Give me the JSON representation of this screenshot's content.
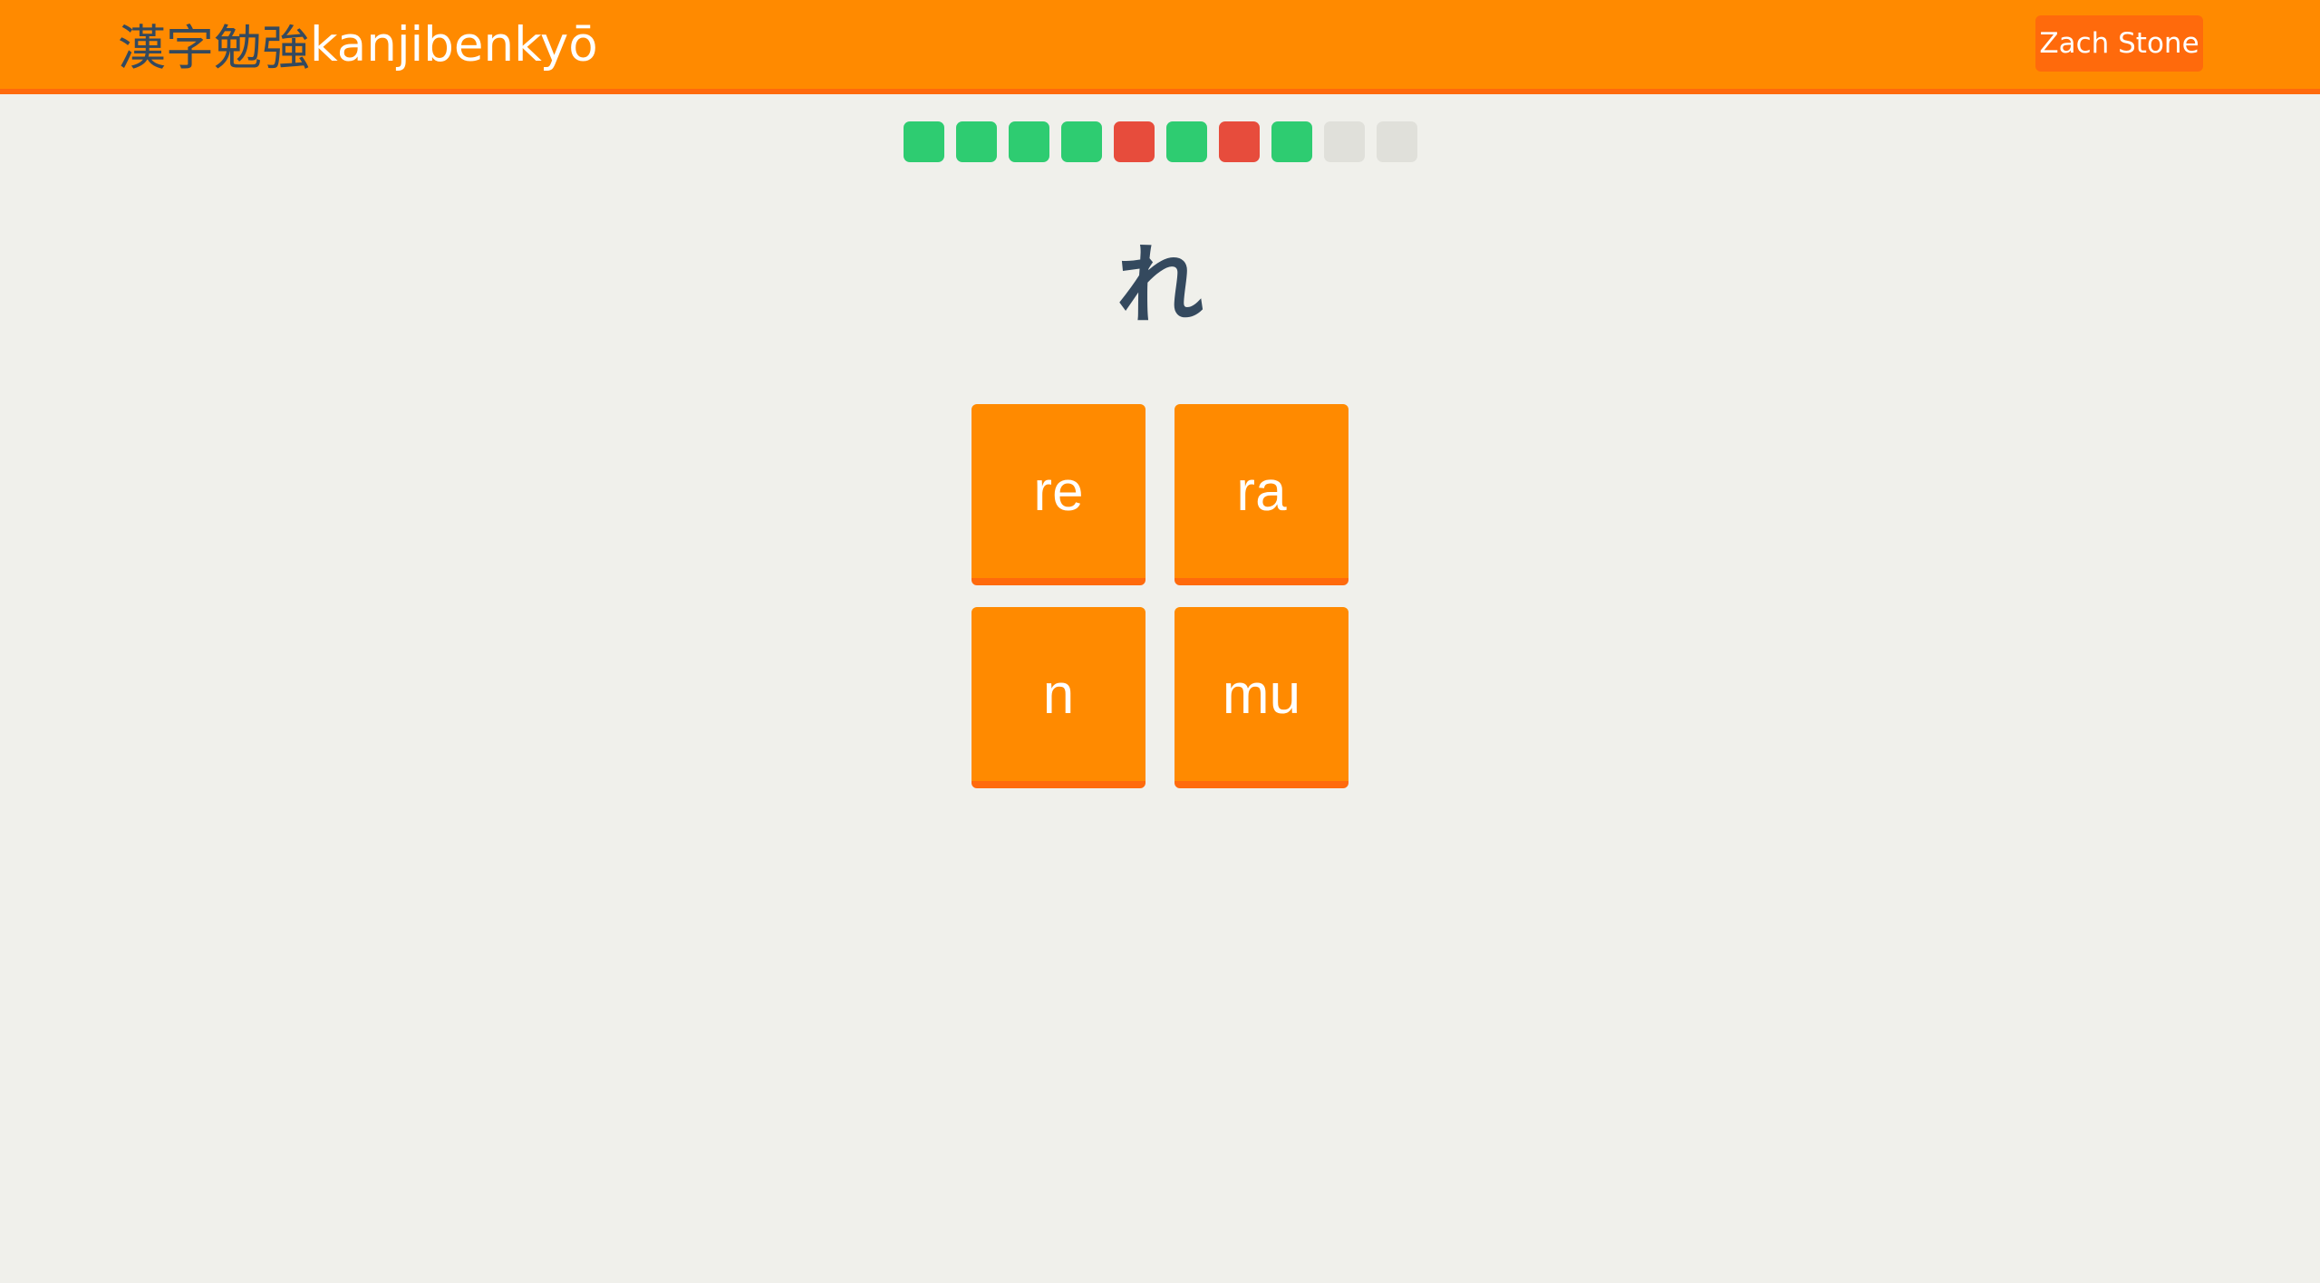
{
  "header": {
    "brand_kanji": "漢字勉強",
    "brand_romaji": "kanjibenkyō",
    "user_name": "Zach Stone"
  },
  "progress": [
    "correct",
    "correct",
    "correct",
    "correct",
    "wrong",
    "correct",
    "wrong",
    "correct",
    "pending",
    "pending"
  ],
  "question": {
    "character": "れ"
  },
  "answers": [
    "re",
    "ra",
    "n",
    "mu"
  ],
  "colors": {
    "accent": "#ff8a00",
    "accent_dark": "#ff6a0c",
    "correct": "#2ecc71",
    "wrong": "#e74c3c",
    "pending": "#e0e0da",
    "text_dark": "#34495e",
    "background": "#f0f0eb"
  }
}
